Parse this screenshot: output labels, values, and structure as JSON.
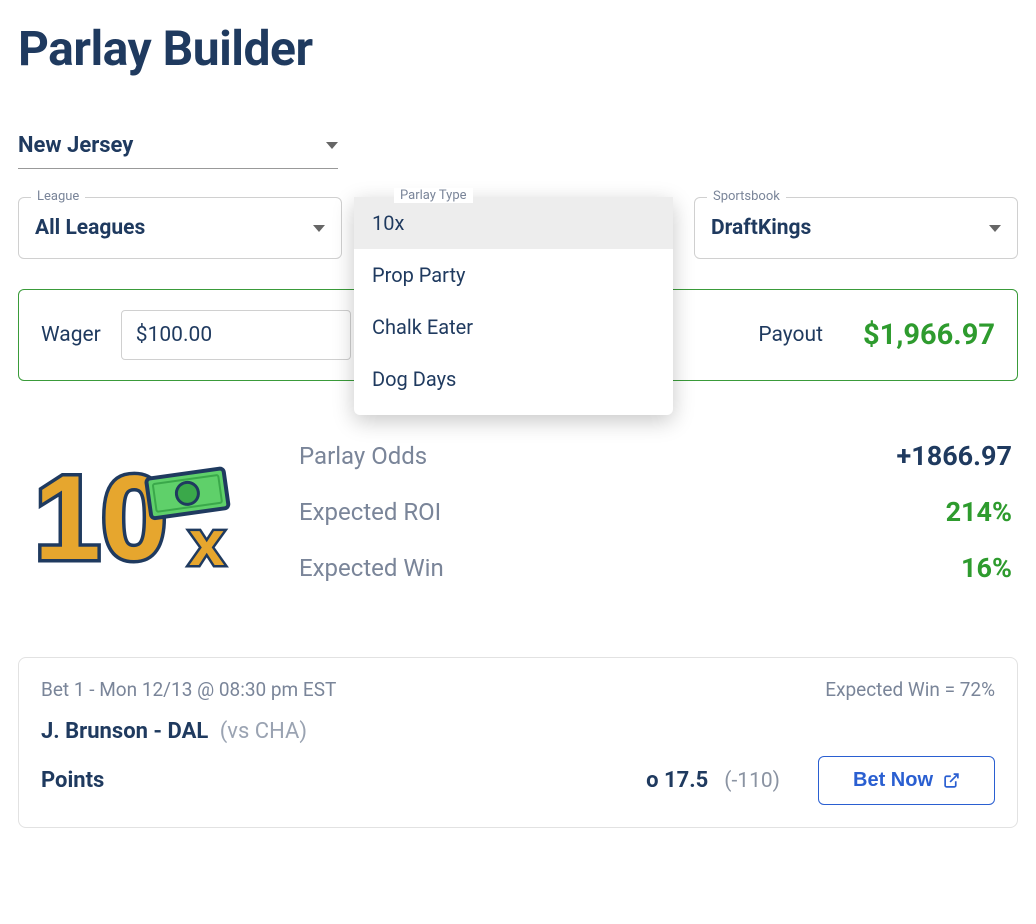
{
  "title": "Parlay Builder",
  "state": "New Jersey",
  "filters": {
    "league": {
      "label": "League",
      "value": "All Leagues"
    },
    "parlay_type": {
      "label": "Parlay Type",
      "options": [
        "10x",
        "Prop Party",
        "Chalk Eater",
        "Dog Days"
      ],
      "selected_index": 0
    },
    "sportsbook": {
      "label": "Sportsbook",
      "value": "DraftKings"
    }
  },
  "wager": {
    "label": "Wager",
    "value": "$100.00",
    "payout_label": "Payout",
    "payout_value": "$1,966.97"
  },
  "logo": {
    "text_main": "10",
    "text_sub": "x"
  },
  "stats": {
    "parlay_odds": {
      "label": "Parlay Odds",
      "value": "+1866.97"
    },
    "expected_roi": {
      "label": "Expected ROI",
      "value": "214%"
    },
    "expected_win": {
      "label": "Expected Win",
      "value": "16%"
    }
  },
  "bet": {
    "header_left": "Bet 1 - Mon 12/13 @ 08:30 pm EST",
    "header_right": "Expected Win = 72%",
    "player": "J. Brunson - DAL",
    "matchup": "(vs CHA)",
    "metric": "Points",
    "line": "o 17.5",
    "odds": "(-110)",
    "button": "Bet Now"
  }
}
